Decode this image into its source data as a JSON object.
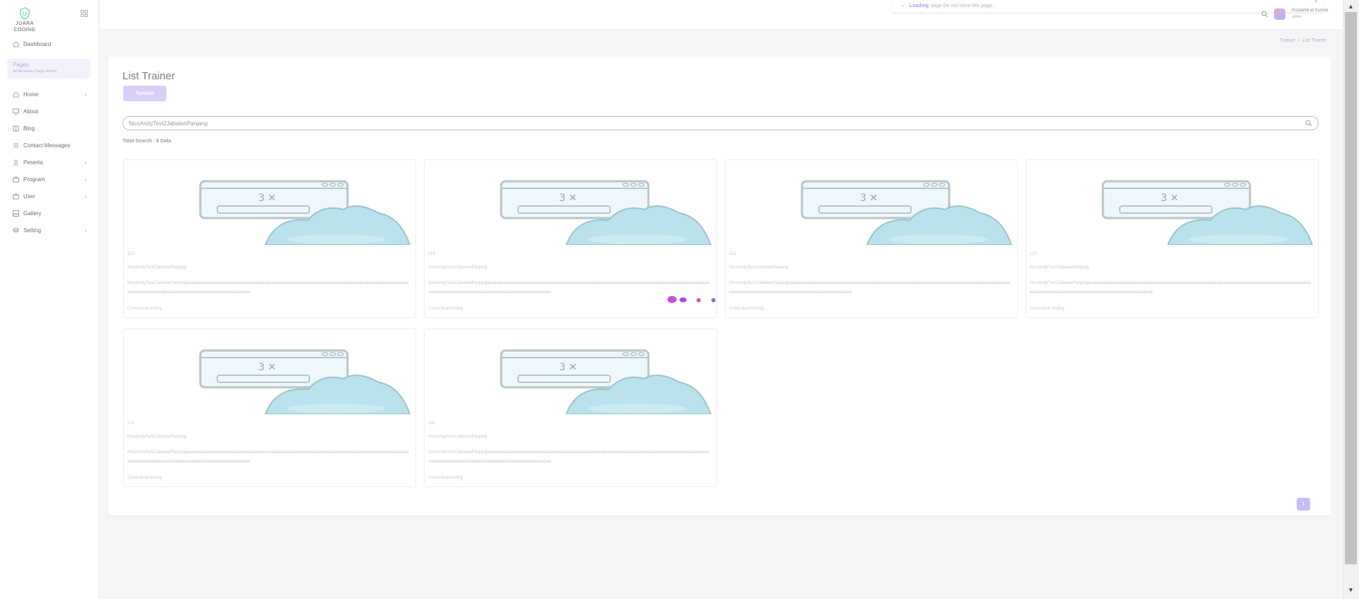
{
  "brand": {
    "line1": "JUARA",
    "line2": "CODING"
  },
  "sidebar": {
    "dashboard": "Dashboard",
    "pages_title": "Pages",
    "pages_sub": "All Necessary Pages Added",
    "items": [
      {
        "label": "Home",
        "icon": "home-icon",
        "has_chevron": true
      },
      {
        "label": "About",
        "icon": "monitor-icon",
        "has_chevron": false
      },
      {
        "label": "Blog",
        "icon": "book-icon",
        "has_chevron": false
      },
      {
        "label": "Contact Messages",
        "icon": "list-icon",
        "has_chevron": false
      },
      {
        "label": "Peserta",
        "icon": "user-icon",
        "has_chevron": true
      },
      {
        "label": "Program",
        "icon": "briefcase-icon",
        "has_chevron": true
      },
      {
        "label": "User",
        "icon": "briefcase-icon",
        "has_chevron": true
      },
      {
        "label": "Gallery",
        "icon": "image-icon",
        "has_chevron": false
      },
      {
        "label": "Setting",
        "icon": "layers-icon",
        "has_chevron": true
      }
    ]
  },
  "toast": {
    "bold": "Loading",
    "rest": "page Do not close this page..."
  },
  "user": {
    "name": "Pustakhil at Suvriat",
    "role": "admin",
    "avatar_letter": "P"
  },
  "breadcrumb": {
    "parent": "Trainer",
    "current": "List Trainer"
  },
  "main": {
    "title": "List Trainer",
    "add_button": "Tambah",
    "search_value": "NicoAndyTest2JabatanPanjang",
    "total_search": "Total Search : 6 Data"
  },
  "cards": [
    {
      "id": "112",
      "name": "NicoAndyTest2JabatanPanjang",
      "desc": "NicoAndyTest2JabatanPanjangaaaaaaaaaaaaaaaaaaaaaaaaaaaaaaaaaaaaaaaaaaaaaaaaaaaaaaaaaaaaaaaaaaaaaaaaaaaaaaaaaaaaaaaaaaaaaaaaaaaaaaaaaaaaaaaaaaaaaaaaaaaaaaaaaaaaaaaaaaaaaaaaaa",
      "note": "Cuma buat testing"
    },
    {
      "id": "114",
      "name": "NicoAndyTest2JabatanPanjang",
      "desc": "NicoAndyTest2JabatanPanjangaaaaaaaaaaaaaaaaaaaaaaaaaaaaaaaaaaaaaaaaaaaaaaaaaaaaaaaaaaaaaaaaaaaaaaaaaaaaaaaaaaaaaaaaaaaaaaaaaaaaaaaaaaaaaaaaaaaaaaaaaaaaaaaaaaaaaaaaaaaaaaaaaa",
      "note": "Cuma buat testing"
    },
    {
      "id": "121",
      "name": "NicoAndyTest2JabatanPanjang",
      "desc": "NicoAndyTest2JabatanPanjangaaaaaaaaaaaaaaaaaaaaaaaaaaaaaaaaaaaaaaaaaaaaaaaaaaaaaaaaaaaaaaaaaaaaaaaaaaaaaaaaaaaaaaaaaaaaaaaaaaaaaaaaaaaaaaaaaaaaaaaaaaaaaaaaaaaaaaaaaaaaaaaaaa",
      "note": "Cuma buat testing"
    },
    {
      "id": "122",
      "name": "NicoAndyTest2JabatanPanjang",
      "desc": "NicoAndyTest2JabatanPanjangaaaaaaaaaaaaaaaaaaaaaaaaaaaaaaaaaaaaaaaaaaaaaaaaaaaaaaaaaaaaaaaaaaaaaaaaaaaaaaaaaaaaaaaaaaaaaaaaaaaaaaaaaaaaaaaaaaaaaaaaaaaaaaaaaaaaaaaaaaaaaaaaaa",
      "note": "Cuma buat testing"
    },
    {
      "id": "131",
      "name": "NicoAndyTest2JabatanPanjang",
      "desc": "NicoAndyTest2JabatanPanjangaaaaaaaaaaaaaaaaaaaaaaaaaaaaaaaaaaaaaaaaaaaaaaaaaaaaaaaaaaaaaaaaaaaaaaaaaaaaaaaaaaaaaaaaaaaaaaaaaaaaaaaaaaaaaaaaaaaaaaaaaaaaaaaaaaaaaaaaaaaaaaaaaa",
      "note": "Cuma buat testing"
    },
    {
      "id": "135",
      "name": "NicoAndyTest2JabatanPanjang",
      "desc": "NicoAndyTest2JabatanPanjangaaaaaaaaaaaaaaaaaaaaaaaaaaaaaaaaaaaaaaaaaaaaaaaaaaaaaaaaaaaaaaaaaaaaaaaaaaaaaaaaaaaaaaaaaaaaaaaaaaaaaaaaaaaaaaaaaaaaaaaaaaaaaaaaaaaaaaaaaaaaaaaaaa",
      "note": "Cuma buat testing"
    }
  ],
  "pagination": {
    "current": "1"
  },
  "colors": {
    "accent": "#7367f0",
    "accent_faded": "#d9cef9",
    "loader": "#c94fe0"
  }
}
